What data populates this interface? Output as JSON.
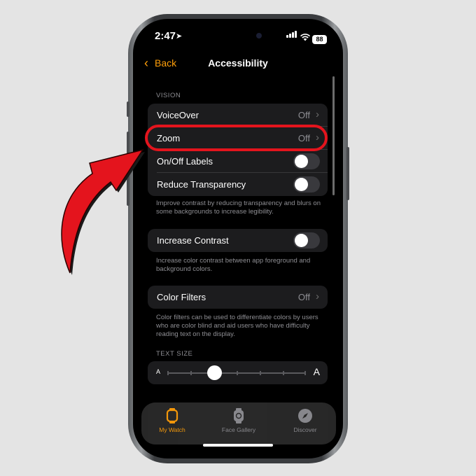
{
  "status_bar": {
    "time": "2:47",
    "battery": "88"
  },
  "nav": {
    "back_label": "Back",
    "title": "Accessibility"
  },
  "vision": {
    "header": "VISION",
    "rows": [
      {
        "label": "VoiceOver",
        "value": "Off"
      },
      {
        "label": "Zoom",
        "value": "Off"
      },
      {
        "label": "On/Off Labels",
        "toggle": false
      },
      {
        "label": "Reduce Transparency",
        "toggle": false
      }
    ],
    "description": "Improve contrast by reducing transparency and blurs on some backgrounds to increase legibility."
  },
  "contrast": {
    "label": "Increase Contrast",
    "toggle": false,
    "description": "Increase color contrast between app foreground and background colors."
  },
  "color_filters": {
    "label": "Color Filters",
    "value": "Off",
    "description": "Color filters can be used to differentiate colors by users who are color blind and aid users who have difficulty reading text on the display."
  },
  "text_size": {
    "header": "TEXT SIZE",
    "small_label": "A",
    "large_label": "A",
    "level": 0.33
  },
  "tabs": [
    {
      "label": "My Watch",
      "icon": "watch-icon",
      "active": true
    },
    {
      "label": "Face Gallery",
      "icon": "face-gallery-icon",
      "active": false
    },
    {
      "label": "Discover",
      "icon": "compass-icon",
      "active": false
    }
  ],
  "colors": {
    "accent": "#ff9f0a",
    "highlight": "#e4141d",
    "background": "#000000",
    "cell": "#1c1c1e"
  }
}
